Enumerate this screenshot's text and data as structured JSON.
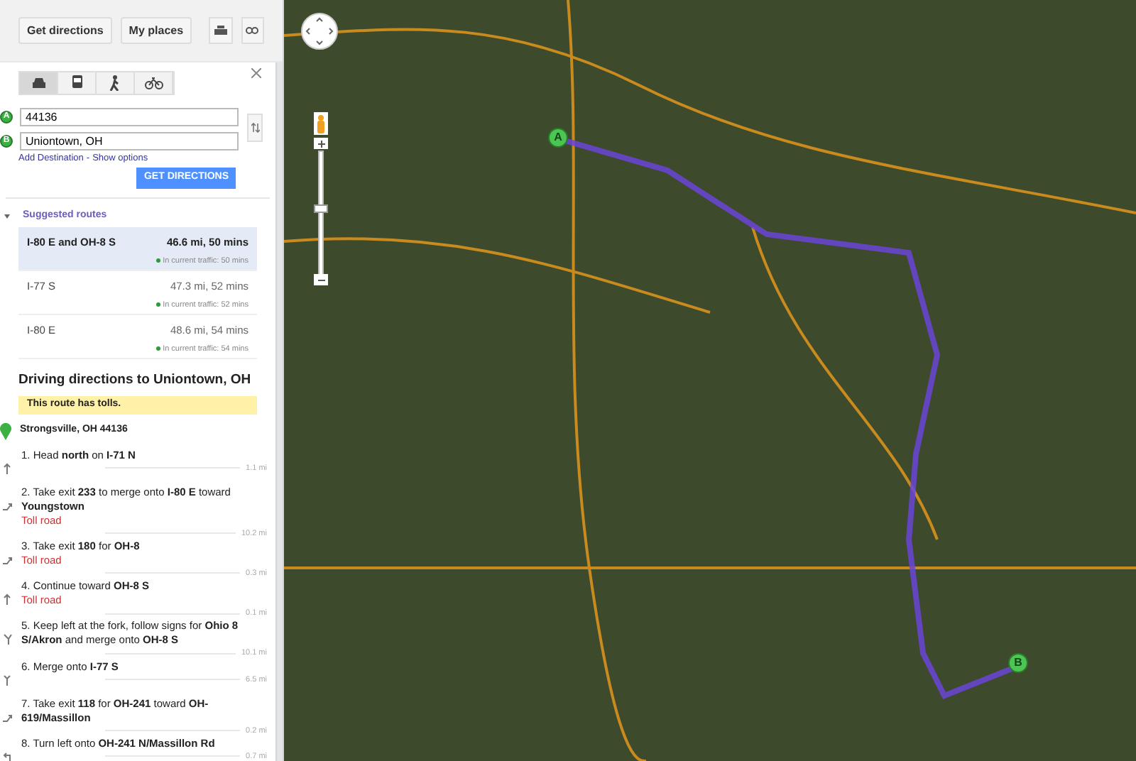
{
  "top_buttons": [
    {
      "label": "Get directions"
    },
    {
      "label": "My places"
    }
  ],
  "modes": [
    {
      "kind": "car",
      "selected": true
    },
    {
      "kind": "transit",
      "selected": false
    },
    {
      "kind": "walk",
      "selected": false
    },
    {
      "kind": "bike",
      "selected": false
    }
  ],
  "waypoints": [
    {
      "marker": "A",
      "value": "44136"
    },
    {
      "marker": "B",
      "value": "Uniontown, OH"
    }
  ],
  "links": [
    "Add Destination",
    "Show options"
  ],
  "link_separator": "-",
  "submit": "GET DIRECTIONS",
  "suggested_routes": {
    "title": "Suggested routes",
    "expanded": true,
    "routes": [
      {
        "name": "I-80 E and OH-8 S",
        "summary": "46.6 mi, 50 mins",
        "traffic": "In current traffic: 50 mins",
        "selected": true
      },
      {
        "name": "I-77 S",
        "summary": "47.3 mi, 52 mins",
        "traffic": "In current traffic: 52 mins",
        "selected": false
      },
      {
        "name": "I-80 E",
        "summary": "48.6 mi, 54 mins",
        "traffic": "In current traffic: 54 mins",
        "selected": false
      }
    ]
  },
  "directions": {
    "title": "Driving directions to Uniontown, OH",
    "notice": "This route has tolls.",
    "start": "Strongsville, OH 44136",
    "steps": [
      {
        "kind": "straight",
        "text": "1. Head **north** on **I-71 N**",
        "distance": "1.1 mi"
      },
      {
        "kind": "ramp",
        "text": "2. Take exit **233** to merge onto **I-80 E** toward **Youngstown**",
        "note": "Toll road",
        "distance": "10.2 mi"
      },
      {
        "kind": "ramp",
        "text": "3. Take exit **180** for **OH-8**",
        "note": "Toll road",
        "distance": "0.3 mi"
      },
      {
        "kind": "straight",
        "text": "4. Continue toward **OH-8 S**",
        "note": "Toll road",
        "distance": "0.1 mi"
      },
      {
        "kind": "fork",
        "text": "5. Keep left at the fork, follow signs for **Ohio 8 S/Akron** and merge onto **OH-8 S**",
        "distance": "10.1 mi"
      },
      {
        "kind": "merge",
        "text": "6. Merge onto **I-77 S**",
        "distance": "6.5 mi"
      },
      {
        "kind": "ramp",
        "text": "7. Take exit **118** for **OH-241** toward **OH-619/Massillon**",
        "distance": "0.2 mi"
      },
      {
        "kind": "left",
        "text": "8. Turn left onto **OH-241 N/Massillon Rd**",
        "distance": "0.7 mi"
      }
    ]
  },
  "map": {
    "markers": [
      "A",
      "B"
    ]
  }
}
